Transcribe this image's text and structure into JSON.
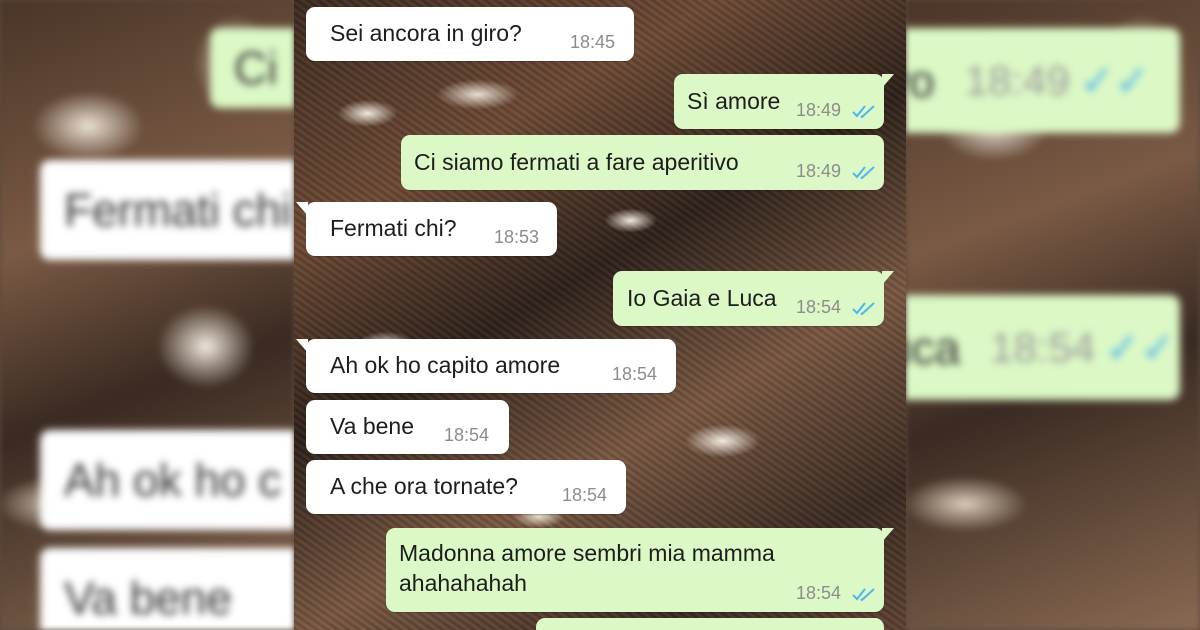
{
  "colors": {
    "incoming_bubble": "#ffffff",
    "outgoing_bubble": "#dcf8c6",
    "time_text": "#8c8c8c",
    "read_tick": "#4fb6ec"
  },
  "icons": {
    "read_receipt": "double-check-icon"
  },
  "messages": [
    {
      "direction": "incoming",
      "text": "Sei ancora in giro?",
      "time": "18:45"
    },
    {
      "direction": "outgoing",
      "text": "Sì amore",
      "time": "18:49",
      "status": "read"
    },
    {
      "direction": "outgoing",
      "text": "Ci siamo fermati a fare aperitivo",
      "time": "18:49",
      "status": "read"
    },
    {
      "direction": "incoming",
      "text": "Fermati chi?",
      "time": "18:53"
    },
    {
      "direction": "outgoing",
      "text": "Io Gaia e Luca",
      "time": "18:54",
      "status": "read"
    },
    {
      "direction": "incoming",
      "text": "Ah ok ho capito amore",
      "time": "18:54"
    },
    {
      "direction": "incoming",
      "text": "Va bene",
      "time": "18:54"
    },
    {
      "direction": "incoming",
      "text": "A che ora tornate?",
      "time": "18:54"
    },
    {
      "direction": "outgoing",
      "text_line1": "Madonna amore sembri mia mamma",
      "text_line2": "ahahahahah",
      "time": "18:54",
      "status": "read"
    }
  ],
  "background_left": {
    "ghost1": "Ci",
    "ghost2": "Fermati chi",
    "ghost3": "Ah ok ho c",
    "ghost4": "Va bene"
  },
  "background_right": {
    "ghost1": "vo",
    "ghost1_time": "18:49",
    "ghost2": "uca",
    "ghost2_time": "18:54"
  }
}
